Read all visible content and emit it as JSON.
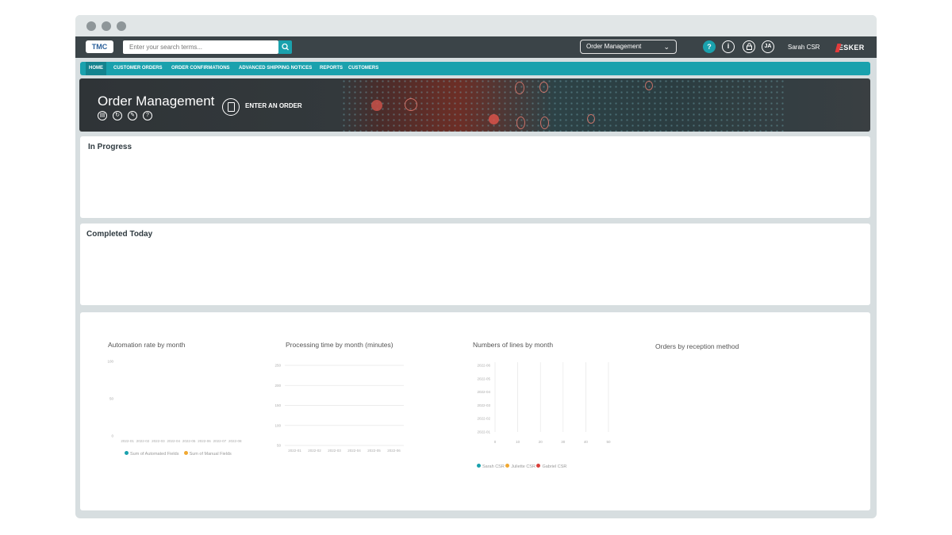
{
  "header": {
    "logo": "TMC",
    "search_placeholder": "Enter your search terms...",
    "module_select": "Order Management",
    "help_label": "?",
    "info_label": "i",
    "avatar_initials": "JA",
    "user_name": "Sarah CSR",
    "brand": "ESKER"
  },
  "nav": {
    "items": [
      "HOME",
      "CUSTOMER ORDERS",
      "ORDER CONFIRMATIONS",
      "ADVANCED SHIPPING NOTICES",
      "REPORTS",
      "CUSTOMERS"
    ]
  },
  "banner": {
    "title": "Order Management",
    "enter_order": "ENTER AN ORDER"
  },
  "panels": {
    "in_progress": "In Progress",
    "completed_today": "Completed Today"
  },
  "colors": {
    "teal": "#1aa1ad",
    "orange": "#f0a832",
    "red": "#d9403b"
  },
  "chart_data": [
    {
      "type": "bar",
      "title": "Automation rate by month",
      "categories": [
        "2022-01",
        "2022-02",
        "2022-03",
        "2022-04",
        "2022-05",
        "2022-06",
        "2022-07",
        "2022-08"
      ],
      "y_ticks": [
        "100",
        "50",
        "0"
      ],
      "ylim": [
        0,
        100
      ],
      "series": [
        {
          "name": "Sum of Automated Fields",
          "values": []
        },
        {
          "name": "Sum of Manual Fields",
          "values": []
        }
      ]
    },
    {
      "type": "line",
      "title": "Processing time by month (minutes)",
      "categories": [
        "2022-01",
        "2022-02",
        "2022-03",
        "2022-04",
        "2022-05",
        "2022-06"
      ],
      "y_ticks": [
        "250",
        "200",
        "150",
        "100",
        "50"
      ],
      "ylim": [
        50,
        250
      ],
      "series": []
    },
    {
      "type": "bar",
      "title": "Numbers of lines by month",
      "categories": [
        "2022-06",
        "2022-05",
        "2022-04",
        "2022-03",
        "2022-02",
        "2022-01"
      ],
      "x_ticks": [
        "0",
        "10",
        "20",
        "30",
        "40",
        "50"
      ],
      "xlim": [
        0,
        50
      ],
      "series": [
        {
          "name": "Sarah CSR",
          "values": []
        },
        {
          "name": "Juliette CSR",
          "values": []
        },
        {
          "name": "Gabriel CSR",
          "values": []
        }
      ]
    },
    {
      "type": "pie",
      "title": "Orders by reception method",
      "series": []
    }
  ]
}
